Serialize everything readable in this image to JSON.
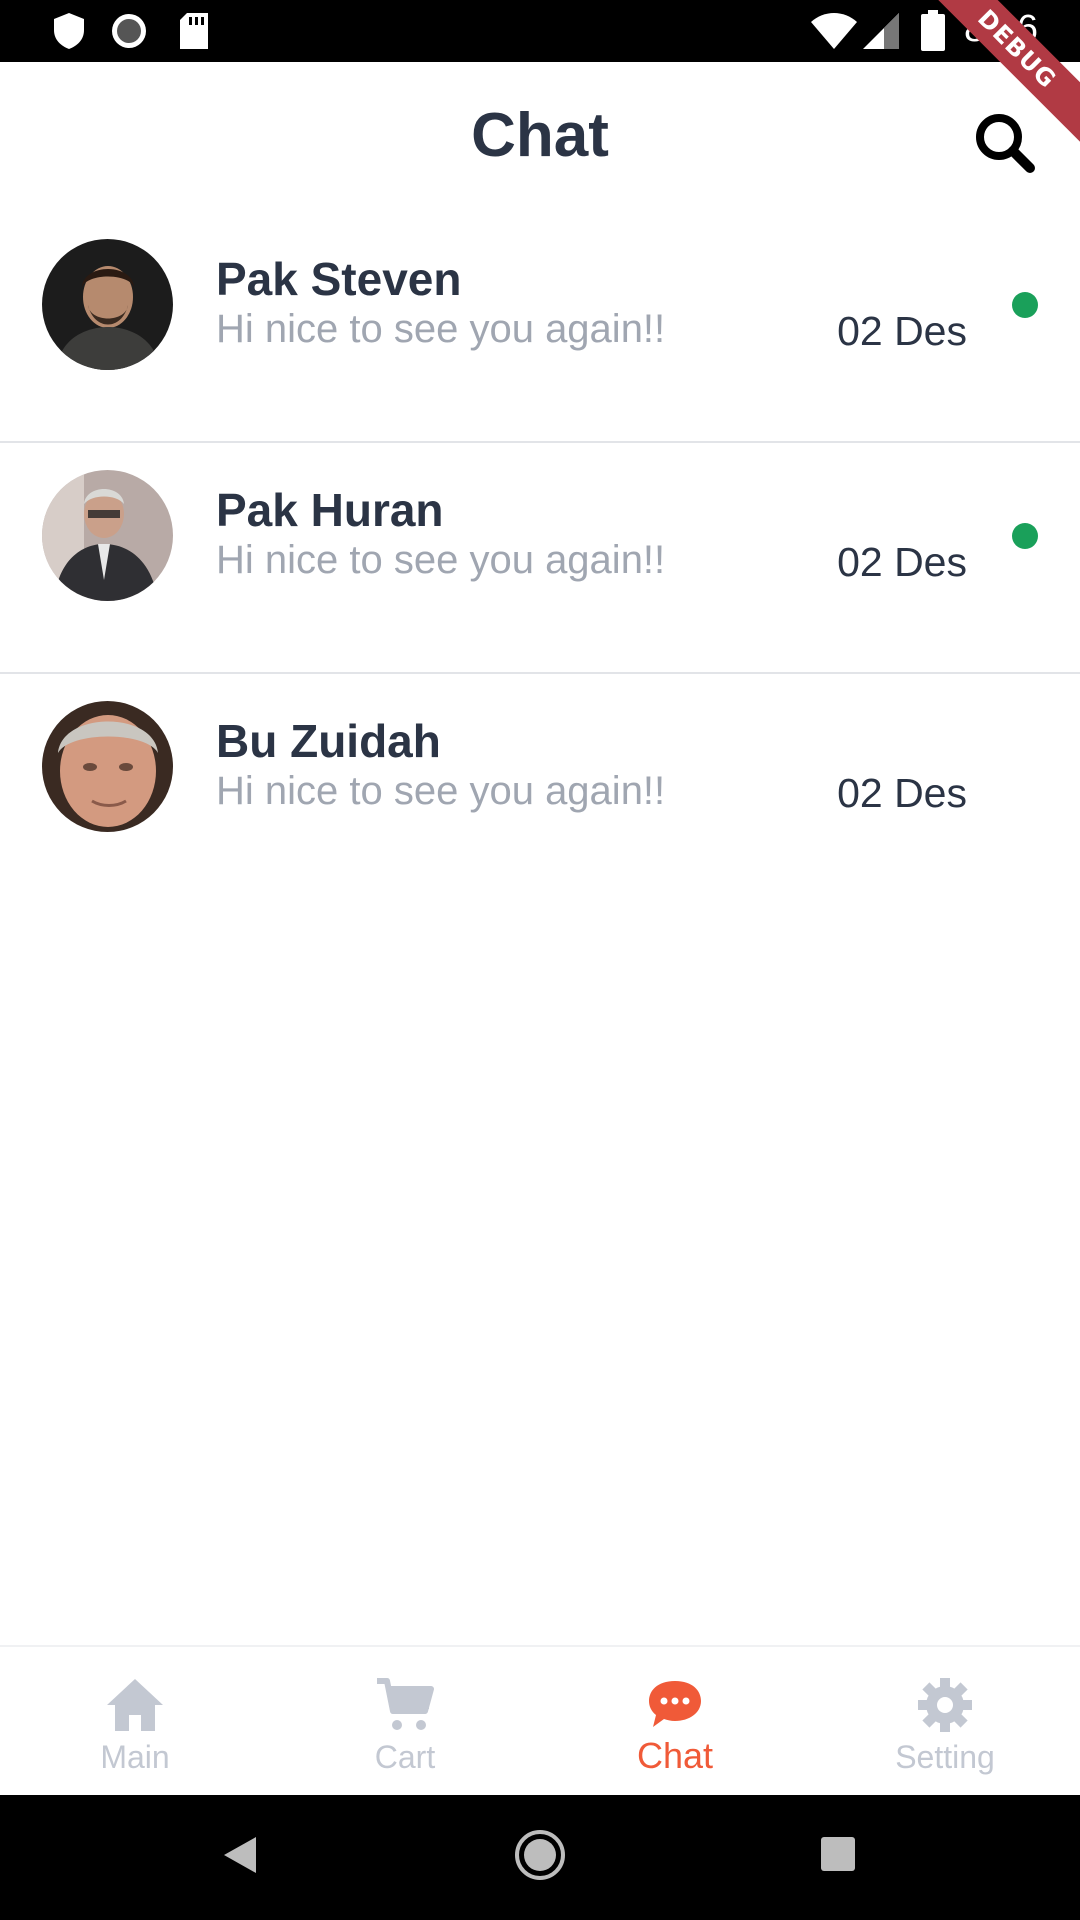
{
  "status_bar": {
    "time": "8:36",
    "icons": [
      "shield-icon",
      "sync-icon",
      "sd-card-icon",
      "wifi-icon",
      "signal-icon",
      "battery-icon"
    ]
  },
  "debug_banner": "DEBUG",
  "app_bar": {
    "title": "Chat",
    "search_icon": "search-icon"
  },
  "chats": [
    {
      "name": "Pak Steven",
      "message": "Hi nice to see you again!!",
      "date": "02 Des",
      "online": true
    },
    {
      "name": "Pak Huran",
      "message": "Hi nice to see you again!!",
      "date": "02 Des",
      "online": true
    },
    {
      "name": "Bu Zuidah",
      "message": "Hi nice to see you again!!",
      "date": "02 Des",
      "online": false
    }
  ],
  "bottom_nav": {
    "items": [
      {
        "label": "Main",
        "icon": "home-icon",
        "active": false
      },
      {
        "label": "Cart",
        "icon": "cart-icon",
        "active": false
      },
      {
        "label": "Chat",
        "icon": "chat-bubble-icon",
        "active": true
      },
      {
        "label": "Setting",
        "icon": "gear-icon",
        "active": false
      }
    ]
  },
  "colors": {
    "accent": "#f05a38",
    "text_dark": "#2b3445",
    "text_muted": "#a0a6b1",
    "inactive_nav": "#c3c8d2",
    "online": "#1aa05a"
  }
}
